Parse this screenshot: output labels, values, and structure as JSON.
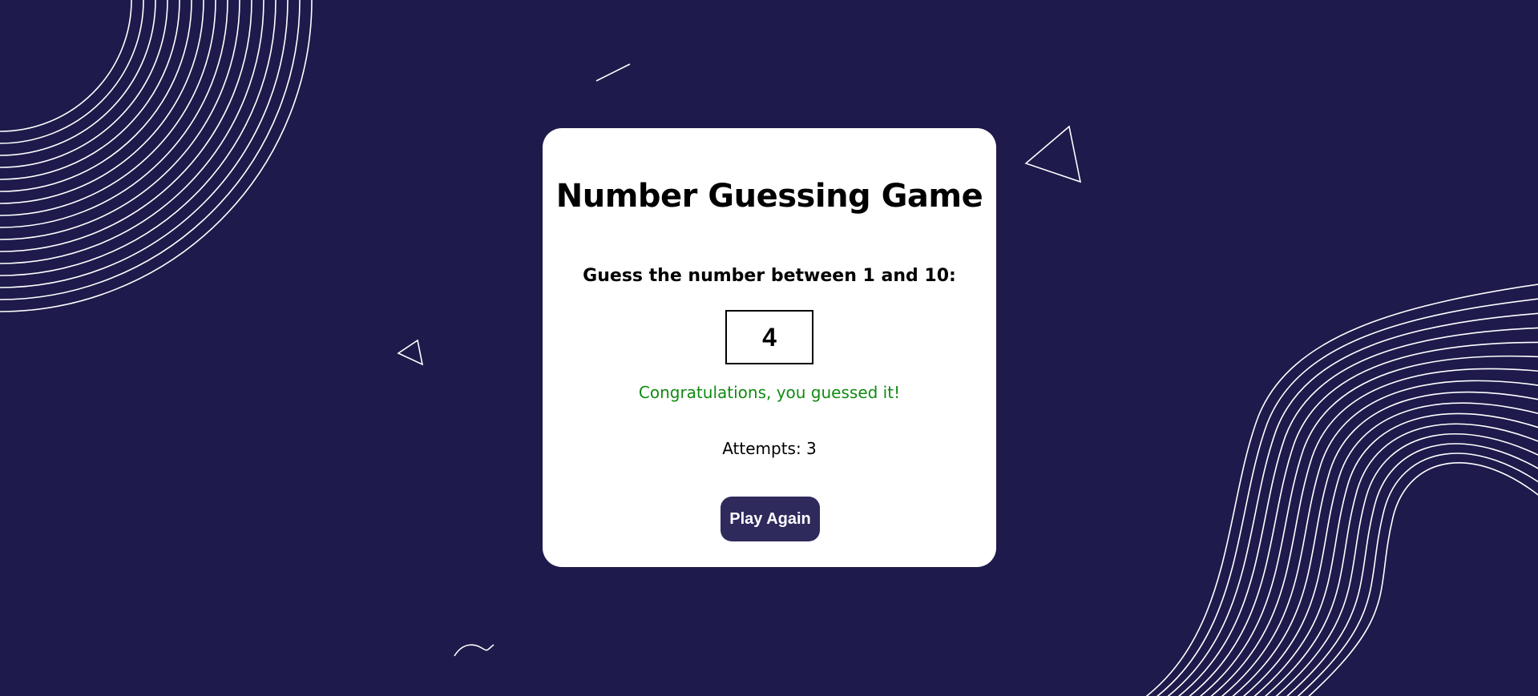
{
  "game": {
    "title": "Number Guessing Game",
    "prompt": "Guess the number between 1 and 10:",
    "guess_value": "4",
    "message": "Congratulations, you guessed it!",
    "attempts_text": "Attempts: 3",
    "play_again_label": "Play Again"
  },
  "colors": {
    "background": "#1e1a4b",
    "card": "#ffffff",
    "message_success": "#118a11",
    "button": "#2f2a5c",
    "decoration_lines": "#ffffff"
  }
}
